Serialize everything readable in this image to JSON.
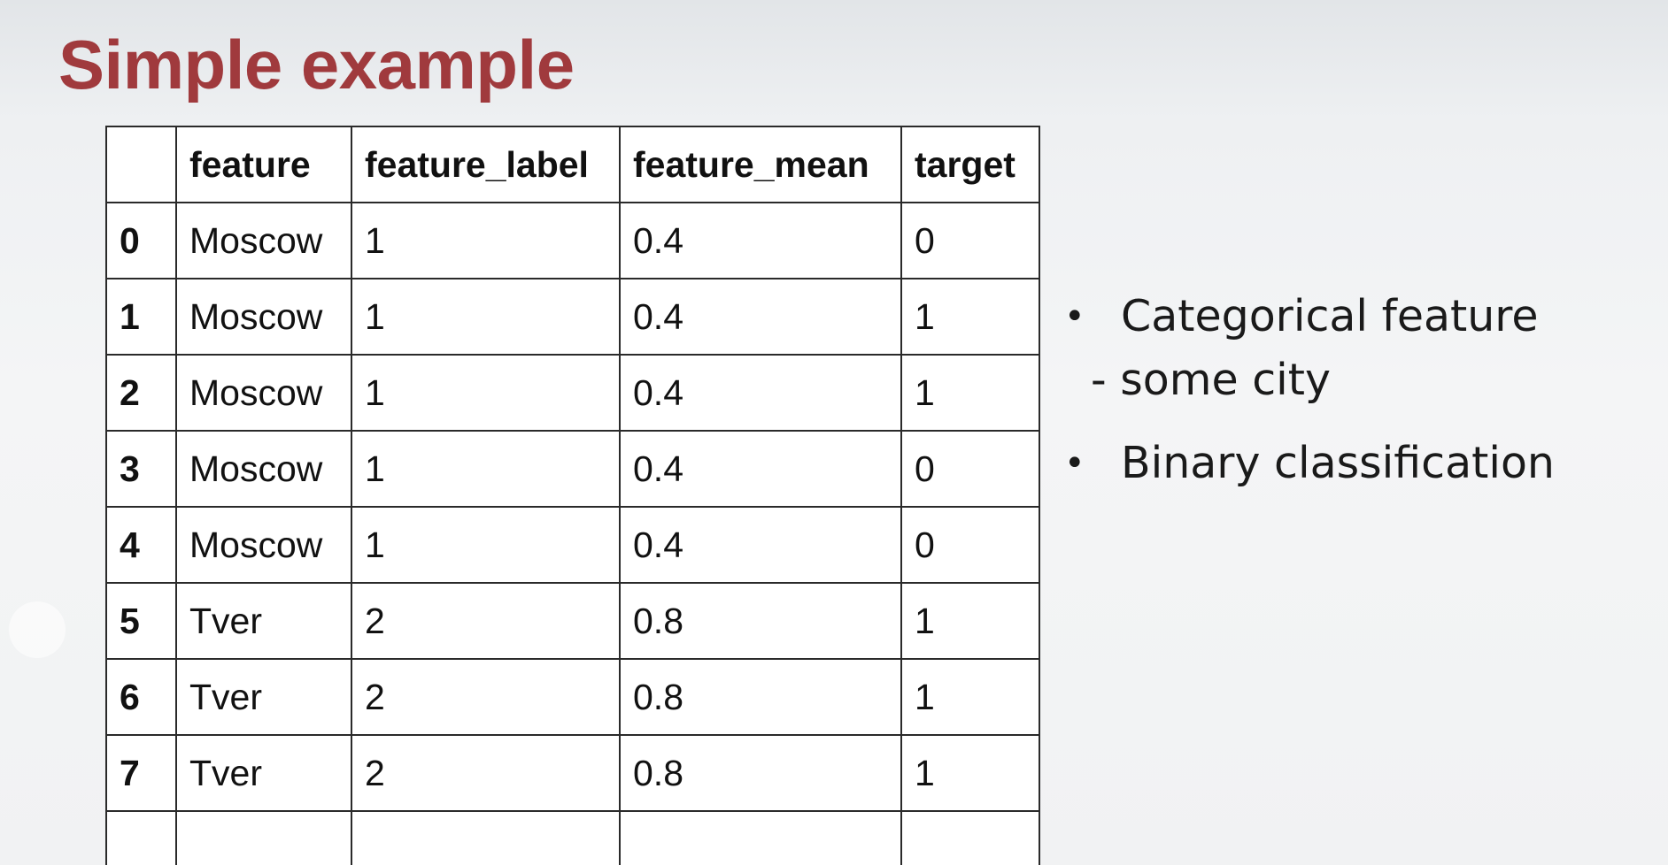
{
  "slide": {
    "title": "Simple example"
  },
  "table": {
    "headers": [
      "",
      "feature",
      "feature_label",
      "feature_mean",
      "target"
    ],
    "rows": [
      [
        "0",
        "Moscow",
        "1",
        "0.4",
        "0"
      ],
      [
        "1",
        "Moscow",
        "1",
        "0.4",
        "1"
      ],
      [
        "2",
        "Moscow",
        "1",
        "0.4",
        "1"
      ],
      [
        "3",
        "Moscow",
        "1",
        "0.4",
        "0"
      ],
      [
        "4",
        "Moscow",
        "1",
        "0.4",
        "0"
      ],
      [
        "5",
        "Tver",
        "2",
        "0.8",
        "1"
      ],
      [
        "6",
        "Tver",
        "2",
        "0.8",
        "1"
      ],
      [
        "7",
        "Tver",
        "2",
        "0.8",
        "1"
      ],
      [
        "",
        "",
        "",
        "",
        ""
      ]
    ]
  },
  "bullets": [
    {
      "text": "Categorical feature",
      "sub": "- some city"
    },
    {
      "text": "Binary classification",
      "sub": ""
    }
  ],
  "bullet_symbol": "•",
  "colors": {
    "title": "#a03a3d",
    "table_border": "#2a2a2a",
    "table_background": "#ffffff"
  }
}
